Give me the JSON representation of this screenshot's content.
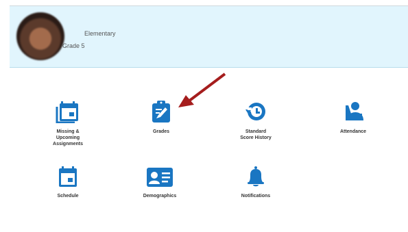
{
  "student": {
    "school": "Elementary",
    "grade": "Grade 5"
  },
  "tiles": [
    {
      "label": "Missing &\nUpcoming\nAssignments",
      "icon": "missing-assignments-icon"
    },
    {
      "label": "Grades",
      "icon": "grades-icon"
    },
    {
      "label": "Standard\nScore History",
      "icon": "score-history-icon"
    },
    {
      "label": "Attendance",
      "icon": "attendance-icon"
    },
    {
      "label": "Schedule",
      "icon": "schedule-icon"
    },
    {
      "label": "Demographics",
      "icon": "demographics-icon"
    },
    {
      "label": "Notifications",
      "icon": "notifications-icon"
    }
  ],
  "colors": {
    "icon_blue": "#1a76c2",
    "header_bg": "#e1f5fd",
    "arrow_red": "#a51d1d"
  }
}
